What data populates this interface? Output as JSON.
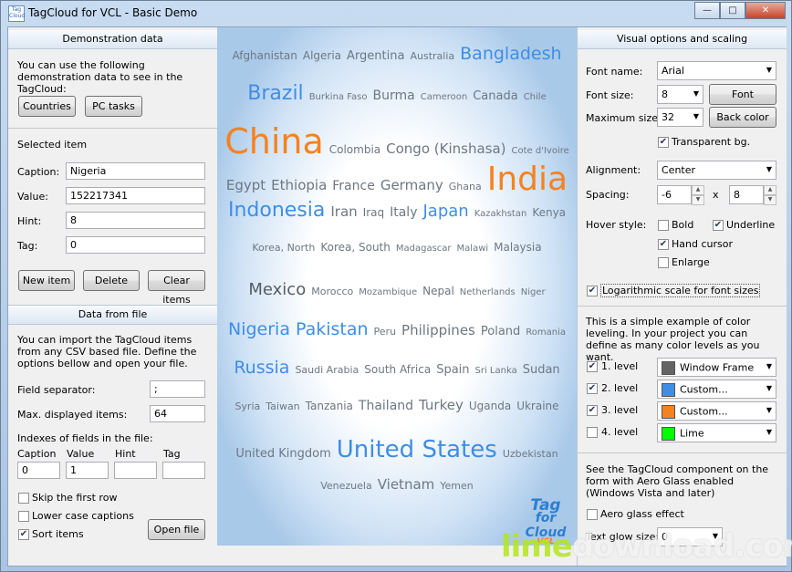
{
  "window": {
    "title": "TagCloud for VCL - Basic Demo",
    "icon_text": "Tag Cloud VCL"
  },
  "left": {
    "demo_header": "Demonstration data",
    "demo_text": "You can use the following demonstration data to see in the TagCloud:",
    "countries_button": "Countries",
    "pctasks_button": "PC tasks",
    "selected_header": "Selected item",
    "caption_label": "Caption:",
    "caption_value": "Nigeria",
    "value_label": "Value:",
    "value_value": "152217341",
    "hint_label": "Hint:",
    "hint_value": "8",
    "tag_label": "Tag:",
    "tag_value": "0",
    "new_item_button": "New item",
    "delete_button": "Delete",
    "clear_items_button": "Clear items",
    "file_header": "Data from file",
    "file_text": "You can import the TagCloud items from any CSV based file. Define the options bellow and open your file.",
    "field_sep_label": "Field separator:",
    "field_sep_value": ";",
    "max_items_label": "Max. displayed items:",
    "max_items_value": "64",
    "indexes_label": "Indexes of fields in the file:",
    "idx_caption_label": "Caption",
    "idx_caption_value": "0",
    "idx_value_label": "Value",
    "idx_value_value": "1",
    "idx_hint_label": "Hint",
    "idx_hint_value": "",
    "idx_tag_label": "Tag",
    "idx_tag_value": "",
    "skip_first_label": "Skip the first row",
    "skip_first_checked": false,
    "lower_case_label": "Lower case captions",
    "lower_case_checked": false,
    "sort_items_label": "Sort items",
    "sort_items_checked": true,
    "open_file_button": "Open file"
  },
  "cloud": {
    "lines": [
      [
        {
          "t": "Afghanistan",
          "s": 12,
          "c": "#6e7782"
        },
        {
          "t": "Algeria",
          "s": 12,
          "c": "#6e7782"
        },
        {
          "t": "Argentina",
          "s": 13,
          "c": "#6e7782"
        },
        {
          "t": "Australia",
          "s": 11,
          "c": "#6e7782"
        },
        {
          "t": "Bangladesh",
          "s": 19,
          "c": "#3e8ee5"
        }
      ],
      [
        {
          "t": "Brazil",
          "s": 22,
          "c": "#3e8ee5"
        },
        {
          "t": "Burkina Faso",
          "s": 10,
          "c": "#6e7782"
        },
        {
          "t": "Burma",
          "s": 14,
          "c": "#6e7782"
        },
        {
          "t": "Cameroon",
          "s": 10,
          "c": "#6e7782"
        },
        {
          "t": "Canada",
          "s": 13,
          "c": "#6e7782"
        },
        {
          "t": "Chile",
          "s": 10,
          "c": "#6e7782"
        }
      ],
      [
        {
          "t": "China",
          "s": 38,
          "c": "#f58220"
        },
        {
          "t": "Colombia",
          "s": 12,
          "c": "#6e7782"
        },
        {
          "t": "Congo (Kinshasa)",
          "s": 15,
          "c": "#6e7782"
        },
        {
          "t": "Cote d'Ivoire",
          "s": 10,
          "c": "#6e7782"
        }
      ],
      [
        {
          "t": "Egypt",
          "s": 15,
          "c": "#6e7782"
        },
        {
          "t": "Ethiopia",
          "s": 15,
          "c": "#6e7782"
        },
        {
          "t": "France",
          "s": 14,
          "c": "#6e7782"
        },
        {
          "t": "Germany",
          "s": 15,
          "c": "#6e7782"
        },
        {
          "t": "Ghana",
          "s": 11,
          "c": "#6e7782"
        },
        {
          "t": "India",
          "s": 36,
          "c": "#f58220"
        }
      ],
      [
        {
          "t": "Indonesia",
          "s": 22,
          "c": "#3e8ee5"
        },
        {
          "t": "Iran",
          "s": 15,
          "c": "#6e7782"
        },
        {
          "t": "Iraq",
          "s": 12,
          "c": "#6e7782"
        },
        {
          "t": "Italy",
          "s": 14,
          "c": "#6e7782"
        },
        {
          "t": "Japan",
          "s": 18,
          "c": "#3e8ee5"
        },
        {
          "t": "Kazakhstan",
          "s": 10,
          "c": "#6e7782"
        },
        {
          "t": "Kenya",
          "s": 12,
          "c": "#6e7782"
        }
      ],
      [
        {
          "t": "Korea, North",
          "s": 11,
          "c": "#6e7782"
        },
        {
          "t": "Korea, South",
          "s": 12,
          "c": "#6e7782"
        },
        {
          "t": "Madagascar",
          "s": 10,
          "c": "#6e7782"
        },
        {
          "t": "Malawi",
          "s": 10,
          "c": "#6e7782"
        },
        {
          "t": "Malaysia",
          "s": 12,
          "c": "#6e7782"
        }
      ],
      [
        {
          "t": "Mexico",
          "s": 18,
          "c": "#555d66"
        },
        {
          "t": "Morocco",
          "s": 11,
          "c": "#6e7782"
        },
        {
          "t": "Mozambique",
          "s": 10,
          "c": "#6e7782"
        },
        {
          "t": "Nepal",
          "s": 12,
          "c": "#6e7782"
        },
        {
          "t": "Netherlands",
          "s": 10,
          "c": "#6e7782"
        },
        {
          "t": "Niger",
          "s": 10,
          "c": "#6e7782"
        }
      ],
      [
        {
          "t": "Nigeria",
          "s": 19,
          "c": "#3e8ee5"
        },
        {
          "t": "Pakistan",
          "s": 19,
          "c": "#3e8ee5"
        },
        {
          "t": "Peru",
          "s": 11,
          "c": "#6e7782"
        },
        {
          "t": "Philippines",
          "s": 15,
          "c": "#6e7782"
        },
        {
          "t": "Poland",
          "s": 13,
          "c": "#6e7782"
        },
        {
          "t": "Romania",
          "s": 10,
          "c": "#6e7782"
        }
      ],
      [
        {
          "t": "Russia",
          "s": 19,
          "c": "#3e8ee5"
        },
        {
          "t": "Saudi Arabia",
          "s": 11,
          "c": "#6e7782"
        },
        {
          "t": "South Africa",
          "s": 12,
          "c": "#6e7782"
        },
        {
          "t": "Spain",
          "s": 13,
          "c": "#6e7782"
        },
        {
          "t": "Sri Lanka",
          "s": 10,
          "c": "#6e7782"
        },
        {
          "t": "Sudan",
          "s": 13,
          "c": "#6e7782"
        }
      ],
      [
        {
          "t": "Syria",
          "s": 11,
          "c": "#6e7782"
        },
        {
          "t": "Taiwan",
          "s": 11,
          "c": "#6e7782"
        },
        {
          "t": "Tanzania",
          "s": 12,
          "c": "#6e7782"
        },
        {
          "t": "Thailand",
          "s": 14,
          "c": "#6e7782"
        },
        {
          "t": "Turkey",
          "s": 15,
          "c": "#6e7782"
        },
        {
          "t": "Uganda",
          "s": 12,
          "c": "#6e7782"
        },
        {
          "t": "Ukraine",
          "s": 12,
          "c": "#6e7782"
        }
      ],
      [
        {
          "t": "United Kingdom",
          "s": 13,
          "c": "#6e7782"
        },
        {
          "t": "United States",
          "s": 26,
          "c": "#3e8ee5"
        },
        {
          "t": "Uzbekistan",
          "s": 11,
          "c": "#6e7782"
        }
      ],
      [
        {
          "t": "Venezuela",
          "s": 11,
          "c": "#6e7782"
        },
        {
          "t": "Vietnam",
          "s": 15,
          "c": "#6e7782"
        },
        {
          "t": "Yemen",
          "s": 11,
          "c": "#6e7782"
        }
      ]
    ],
    "logo_line1": "Tag",
    "logo_line2": "for Cloud",
    "logo_line3": "VCL"
  },
  "right": {
    "visual_header": "Visual options and scaling",
    "font_name_label": "Font name:",
    "font_name_value": "Arial",
    "font_size_label": "Font size:",
    "font_size_value": "8",
    "font_button": "Font",
    "max_size_label": "Maximum size:",
    "max_size_value": "32",
    "back_color_button": "Back color",
    "transparent_label": "Transparent bg.",
    "transparent_checked": true,
    "alignment_label": "Alignment:",
    "alignment_value": "Center",
    "spacing_label": "Spacing:",
    "spacing_x_value": "-6",
    "spacing_times": "x",
    "spacing_y_value": "8",
    "hover_label": "Hover style:",
    "bold_label": "Bold",
    "bold_checked": false,
    "underline_label": "Underline",
    "underline_checked": true,
    "hand_label": "Hand cursor",
    "hand_checked": true,
    "enlarge_label": "Enlarge",
    "enlarge_checked": false,
    "log_scale_label": "Logarithmic scale for font sizes",
    "log_scale_checked": true,
    "levels_text": "This is a simple example of color leveling. In your project you can define as many color levels as you want.",
    "levels": [
      {
        "label": "1. level",
        "checked": true,
        "color_name": "Window Frame",
        "color": "#646464"
      },
      {
        "label": "2. level",
        "checked": true,
        "color_name": "Custom...",
        "color": "#3e8ee5"
      },
      {
        "label": "3. level",
        "checked": true,
        "color_name": "Custom...",
        "color": "#f58220"
      },
      {
        "label": "4. level",
        "checked": false,
        "color_name": "Lime",
        "color": "#00ff00"
      }
    ],
    "aero_text": "See the TagCloud component on the form with Aero Glass enabled (Windows Vista and later)",
    "aero_label": "Aero glass effect",
    "aero_checked": false,
    "glow_label": "Text glow size:",
    "glow_value": "0"
  },
  "watermark": {
    "part1": "lime",
    "part2": "download.com"
  }
}
